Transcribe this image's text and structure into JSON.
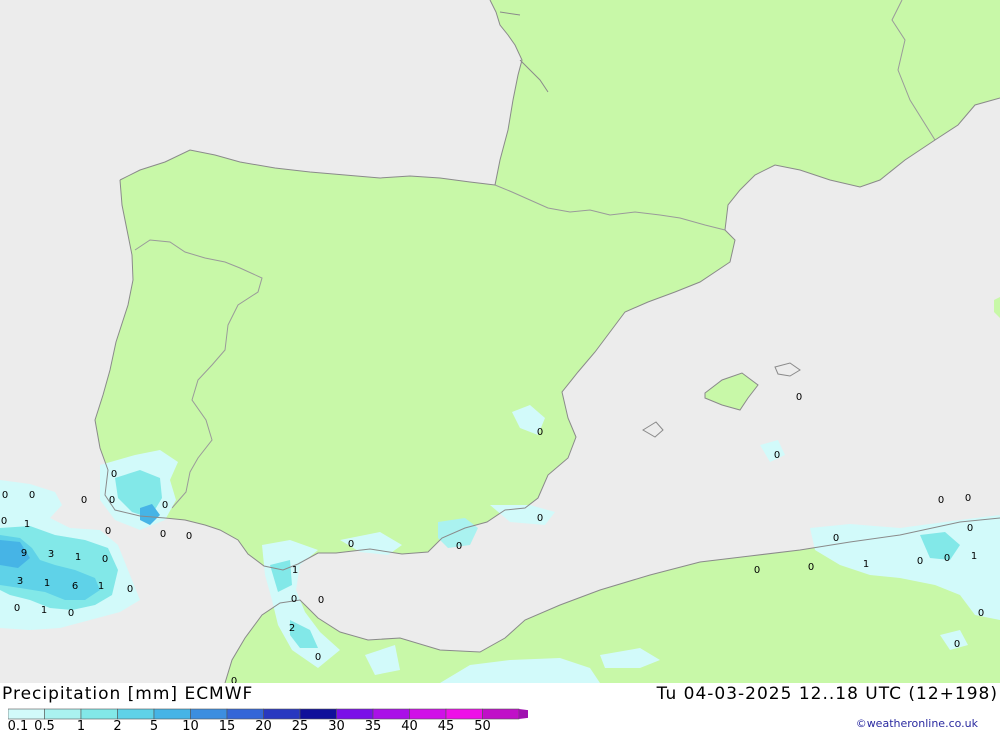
{
  "title": "Precipitation [mm] ECMWF",
  "datetime": "Tu 04-03-2025 12..18 UTC (12+198)",
  "credit": "©weatheronline.co.uk",
  "colors": {
    "sea": "#ececec",
    "land": "#c8f8a8",
    "border": "#9a9a9a",
    "coast": "#8a8a8a"
  },
  "legend": {
    "classes": [
      "0.1",
      "0.5",
      "1",
      "2",
      "5",
      "10",
      "15",
      "20",
      "25",
      "30",
      "35",
      "40",
      "45",
      "50"
    ],
    "colors": [
      "#d2fafa",
      "#aaf2f0",
      "#82e8e8",
      "#5fd2e8",
      "#46b4e6",
      "#3c8ee0",
      "#3366d8",
      "#2838c0",
      "#10109a",
      "#7a10e8",
      "#aa10e8",
      "#d010e8",
      "#ee10e8",
      "#c010c8",
      "#a010b0"
    ]
  },
  "map_labels": [
    {
      "text": "0"
    },
    {
      "text": "0"
    },
    {
      "text": "1"
    },
    {
      "text": "9"
    },
    {
      "text": "3"
    },
    {
      "text": "1"
    },
    {
      "text": "0"
    },
    {
      "text": "3"
    },
    {
      "text": "1"
    },
    {
      "text": "6"
    },
    {
      "text": "1"
    },
    {
      "text": "0"
    },
    {
      "text": "0"
    },
    {
      "text": "1"
    },
    {
      "text": "0"
    },
    {
      "text": "0"
    },
    {
      "text": "0"
    },
    {
      "text": "0"
    },
    {
      "text": "0"
    },
    {
      "text": "0"
    },
    {
      "text": "0"
    },
    {
      "text": "0"
    },
    {
      "text": "0"
    },
    {
      "text": "1"
    },
    {
      "text": "0"
    },
    {
      "text": "0"
    },
    {
      "text": "2"
    },
    {
      "text": "0"
    },
    {
      "text": "0"
    },
    {
      "text": "0"
    },
    {
      "text": "0"
    },
    {
      "text": "0"
    },
    {
      "text": "0"
    },
    {
      "text": "0"
    },
    {
      "text": "0"
    },
    {
      "text": "0"
    },
    {
      "text": "0"
    },
    {
      "text": "1"
    },
    {
      "text": "0"
    },
    {
      "text": "0"
    },
    {
      "text": "1"
    },
    {
      "text": "0"
    },
    {
      "text": "0"
    },
    {
      "text": "0"
    },
    {
      "text": "0"
    },
    {
      "text": "0"
    },
    {
      "text": "0"
    }
  ]
}
